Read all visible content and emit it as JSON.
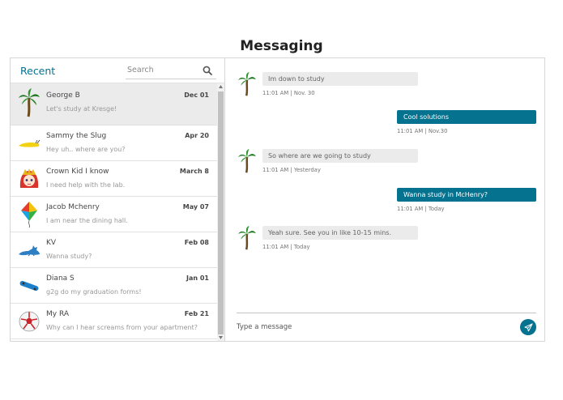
{
  "page": {
    "title": "Messaging"
  },
  "inbox": {
    "heading": "Recent",
    "search_placeholder": "Search",
    "chats": [
      {
        "name": "George B",
        "date": "Dec 01",
        "preview": "Let's study at Kresge!",
        "avatar": "palm-tree-icon"
      },
      {
        "name": "Sammy the Slug",
        "date": "Apr 20",
        "preview": "Hey uh.. where are you?",
        "avatar": "banana-slug-icon"
      },
      {
        "name": "Crown Kid I know",
        "date": "March 8",
        "preview": "I need help with the lab.",
        "avatar": "anime-character-icon"
      },
      {
        "name": "Jacob Mchenry",
        "date": "May 07",
        "preview": "I am near the dining hall.",
        "avatar": "kite-icon"
      },
      {
        "name": "KV",
        "date": "Feb 08",
        "preview": "Wanna study?",
        "avatar": "wolf-icon"
      },
      {
        "name": "Diana S",
        "date": "Jan 01",
        "preview": "g2g do my graduation forms!",
        "avatar": "skateboard-icon"
      },
      {
        "name": "My RA",
        "date": "Feb 21",
        "preview": "Why can I hear screams from your apartment?",
        "avatar": "soccer-ball-icon"
      }
    ]
  },
  "messages": [
    {
      "direction": "incoming",
      "text": "Im down to study",
      "time": "11:01 AM | Nov. 30"
    },
    {
      "direction": "outgoing",
      "text": "Cool solutions",
      "time": "11:01 AM | Nov.30"
    },
    {
      "direction": "incoming",
      "text": "So where are we going to study",
      "time": "11:01 AM | Yesterday"
    },
    {
      "direction": "outgoing",
      "text": "Wanna study in McHenry?",
      "time": "11:01 AM | Today"
    },
    {
      "direction": "incoming",
      "text": "Yeah sure. See you in like 10-15 mins.",
      "time": "11:01 AM | Today"
    }
  ],
  "composer": {
    "placeholder": "Type a message"
  },
  "colors": {
    "accent": "#05728f",
    "bubble_in": "#ebebeb",
    "active_chat": "#ebebeb"
  }
}
